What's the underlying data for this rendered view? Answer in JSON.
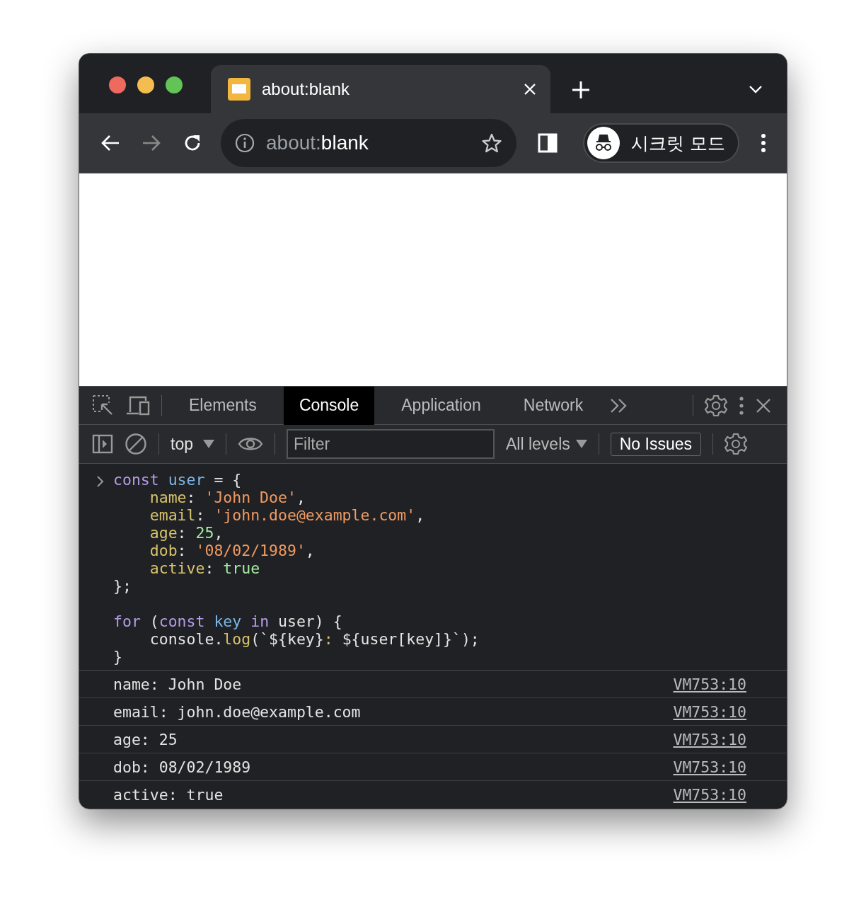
{
  "browser_tabs": [
    {
      "title": "about:blank"
    }
  ],
  "address_bar": {
    "prefix": "about:",
    "host": "blank"
  },
  "profile": {
    "label": "시크릿 모드"
  },
  "devtools": {
    "tabs": [
      {
        "label": "Elements",
        "selected": false
      },
      {
        "label": "Console",
        "selected": true
      },
      {
        "label": "Application",
        "selected": false
      },
      {
        "label": "Network",
        "selected": false
      }
    ],
    "context": "top",
    "filter": {
      "placeholder": "Filter"
    },
    "levels": "All levels",
    "issues": "No Issues",
    "code_blocks": [
      [
        [
          {
            "text": "const",
            "kind": "keyword"
          },
          {
            "text": " user",
            "kind": "variable"
          },
          {
            "text": " = {",
            "kind": "plain"
          }
        ],
        [
          {
            "text": "    name",
            "kind": "property"
          },
          {
            "text": ": ",
            "kind": "plain"
          },
          {
            "text": "'John Doe'",
            "kind": "string"
          },
          {
            "text": ",",
            "kind": "plain"
          }
        ],
        [
          {
            "text": "    email",
            "kind": "property"
          },
          {
            "text": ": ",
            "kind": "plain"
          },
          {
            "text": "'john.doe@example.com'",
            "kind": "string"
          },
          {
            "text": ",",
            "kind": "plain"
          }
        ],
        [
          {
            "text": "    age",
            "kind": "property"
          },
          {
            "text": ": ",
            "kind": "plain"
          },
          {
            "text": "25",
            "kind": "number"
          },
          {
            "text": ",",
            "kind": "plain"
          }
        ],
        [
          {
            "text": "    dob",
            "kind": "property"
          },
          {
            "text": ": ",
            "kind": "plain"
          },
          {
            "text": "'08/02/1989'",
            "kind": "string"
          },
          {
            "text": ",",
            "kind": "plain"
          }
        ],
        [
          {
            "text": "    active",
            "kind": "property"
          },
          {
            "text": ": ",
            "kind": "plain"
          },
          {
            "text": "true",
            "kind": "number"
          }
        ],
        [
          {
            "text": "};",
            "kind": "plain"
          }
        ]
      ],
      [
        [
          {
            "text": "for",
            "kind": "keyword"
          },
          {
            "text": " (",
            "kind": "plain"
          },
          {
            "text": "const",
            "kind": "keyword"
          },
          {
            "text": " key",
            "kind": "variable"
          },
          {
            "text": " in",
            "kind": "keyword"
          },
          {
            "text": " user) {",
            "kind": "plain"
          }
        ],
        [
          {
            "text": "    console.",
            "kind": "plain"
          },
          {
            "text": "log",
            "kind": "property"
          },
          {
            "text": "(`${key}",
            "kind": "plain"
          },
          {
            "text": ": ",
            "kind": "property"
          },
          {
            "text": "${user[key]}`);",
            "kind": "plain"
          }
        ],
        [
          {
            "text": "}",
            "kind": "plain"
          }
        ]
      ]
    ],
    "logs": [
      {
        "message": "name: John Doe",
        "source": "VM753:10"
      },
      {
        "message": "email: john.doe@example.com",
        "source": "VM753:10"
      },
      {
        "message": "age: 25",
        "source": "VM753:10"
      },
      {
        "message": "dob: 08/02/1989",
        "source": "VM753:10"
      },
      {
        "message": "active: true",
        "source": "VM753:10"
      }
    ]
  }
}
